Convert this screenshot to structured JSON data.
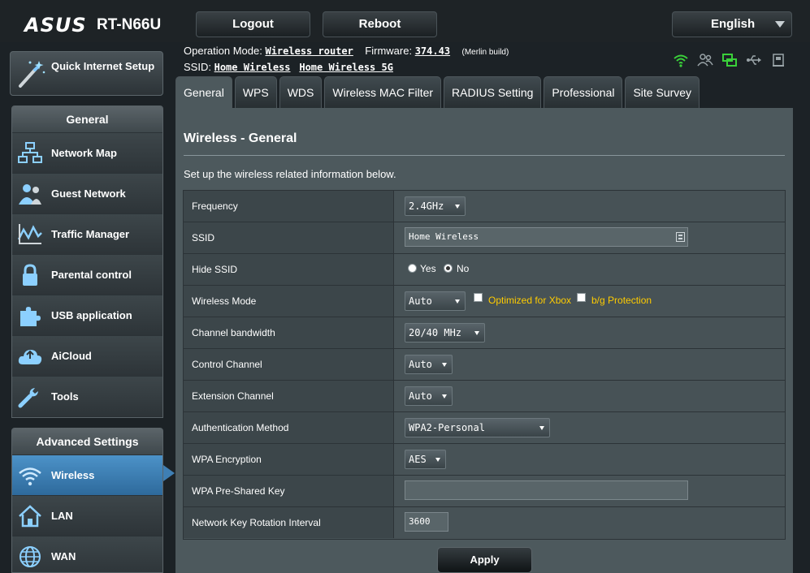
{
  "header": {
    "logo": "ASUS",
    "model": "RT-N66U",
    "logout_label": "Logout",
    "reboot_label": "Reboot",
    "language": "English"
  },
  "info": {
    "operation_mode_label": "Operation Mode:",
    "operation_mode_value": "Wireless router",
    "firmware_label": "Firmware:",
    "firmware_value": "374.43",
    "firmware_note": "(Merlin build)",
    "ssid_label": "SSID:",
    "ssid_24": "Home Wireless",
    "ssid_5": "Home Wireless 5G"
  },
  "status_icons": [
    "wifi-signal-icon",
    "clients-icon",
    "network-icon",
    "usb-icon",
    "printer-icon"
  ],
  "sidebar": {
    "qis_label": "Quick Internet Setup",
    "general_header": "General",
    "general_items": [
      {
        "label": "Network Map",
        "icon": "network-map-icon"
      },
      {
        "label": "Guest Network",
        "icon": "guest-network-icon"
      },
      {
        "label": "Traffic Manager",
        "icon": "traffic-manager-icon"
      },
      {
        "label": "Parental control",
        "icon": "lock-icon"
      },
      {
        "label": "USB application",
        "icon": "puzzle-icon"
      },
      {
        "label": "AiCloud",
        "icon": "cloud-icon"
      },
      {
        "label": "Tools",
        "icon": "wrench-icon"
      }
    ],
    "advanced_header": "Advanced Settings",
    "advanced_items": [
      {
        "label": "Wireless",
        "icon": "wifi-icon",
        "active": true
      },
      {
        "label": "LAN",
        "icon": "home-icon"
      },
      {
        "label": "WAN",
        "icon": "globe-icon"
      }
    ]
  },
  "tabs": [
    {
      "label": "General",
      "active": true
    },
    {
      "label": "WPS"
    },
    {
      "label": "WDS"
    },
    {
      "label": "Wireless MAC Filter"
    },
    {
      "label": "RADIUS Setting"
    },
    {
      "label": "Professional"
    },
    {
      "label": "Site Survey"
    }
  ],
  "panel": {
    "title": "Wireless - General",
    "description": "Set up the wireless related information below.",
    "apply_label": "Apply"
  },
  "form": {
    "frequency": {
      "label": "Frequency",
      "value": "2.4GHz"
    },
    "ssid": {
      "label": "SSID",
      "value": "Home Wireless"
    },
    "hide_ssid": {
      "label": "Hide SSID",
      "yes": "Yes",
      "no": "No",
      "selected": "No"
    },
    "wireless_mode": {
      "label": "Wireless Mode",
      "value": "Auto",
      "xbox_label": "Optimized for Xbox",
      "bg_label": "b/g Protection"
    },
    "channel_bandwidth": {
      "label": "Channel bandwidth",
      "value": "20/40 MHz"
    },
    "control_channel": {
      "label": "Control Channel",
      "value": "Auto"
    },
    "extension_channel": {
      "label": "Extension Channel",
      "value": "Auto"
    },
    "auth_method": {
      "label": "Authentication Method",
      "value": "WPA2-Personal"
    },
    "wpa_encryption": {
      "label": "WPA Encryption",
      "value": "AES"
    },
    "wpa_psk": {
      "label": "WPA Pre-Shared Key",
      "value": ""
    },
    "key_rotation": {
      "label": "Network Key Rotation Interval",
      "value": "3600"
    }
  },
  "colors": {
    "accent_blue": "#3f7fb4",
    "highlight_yellow": "#ffcc00",
    "status_green": "#3ad13a"
  }
}
